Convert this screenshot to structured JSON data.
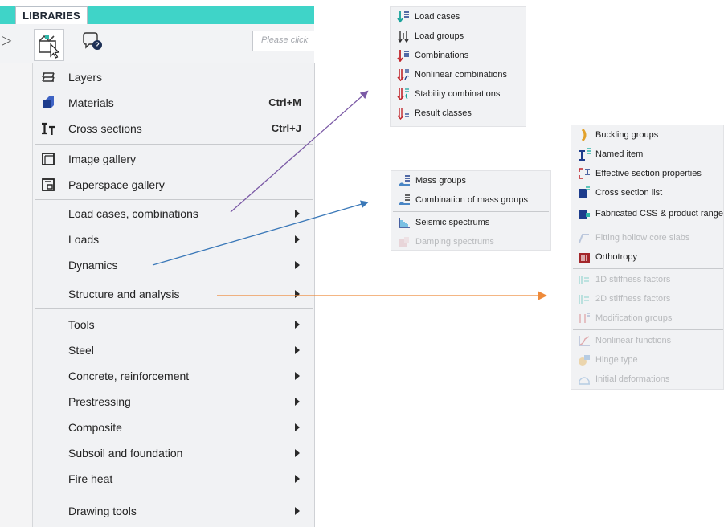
{
  "ribbon": {
    "tab_label": "LIBRARIES",
    "search_placeholder": "Please click"
  },
  "main_menu": {
    "items": [
      {
        "label": "Layers",
        "icon": "layers-icon"
      },
      {
        "label": "Materials",
        "icon": "materials-icon",
        "shortcut": "Ctrl+M"
      },
      {
        "label": "Cross sections",
        "icon": "cross-section-icon",
        "shortcut": "Ctrl+J"
      },
      {
        "label": "Image gallery",
        "icon": "image-gallery-icon"
      },
      {
        "label": "Paperspace gallery",
        "icon": "paperspace-gallery-icon"
      },
      {
        "label": "Load cases, combinations"
      },
      {
        "label": "Loads"
      },
      {
        "label": "Dynamics"
      },
      {
        "label": "Structure and analysis"
      },
      {
        "label": "Tools"
      },
      {
        "label": "Steel"
      },
      {
        "label": "Concrete, reinforcement"
      },
      {
        "label": "Prestressing"
      },
      {
        "label": "Composite"
      },
      {
        "label": "Subsoil and foundation"
      },
      {
        "label": "Fire heat"
      },
      {
        "label": "Drawing tools"
      }
    ]
  },
  "load_cases_submenu": {
    "items": [
      {
        "label": "Load cases"
      },
      {
        "label": "Load groups"
      },
      {
        "label": "Combinations"
      },
      {
        "label": "Nonlinear combinations"
      },
      {
        "label": "Stability combinations"
      },
      {
        "label": "Result classes"
      }
    ]
  },
  "dynamics_submenu": {
    "items": [
      {
        "label": "Mass groups"
      },
      {
        "label": "Combination of mass groups"
      },
      {
        "label": "Seismic spectrums"
      },
      {
        "label": "Damping spectrums",
        "disabled": true
      }
    ]
  },
  "structure_submenu": {
    "items": [
      {
        "label": "Buckling groups"
      },
      {
        "label": "Named item"
      },
      {
        "label": "Effective section properties"
      },
      {
        "label": "Cross section list"
      },
      {
        "label": "Fabricated CSS & product range"
      },
      {
        "label": "Fitting hollow core slabs",
        "disabled": true
      },
      {
        "label": "Orthotropy"
      },
      {
        "label": "1D stiffness factors",
        "disabled": true
      },
      {
        "label": "2D stiffness factors",
        "disabled": true
      },
      {
        "label": "Modification groups",
        "disabled": true
      },
      {
        "label": "Nonlinear functions",
        "disabled": true
      },
      {
        "label": "Hinge type",
        "disabled": true
      },
      {
        "label": "Initial deformations",
        "disabled": true
      }
    ]
  },
  "colors": {
    "ribbon_accent": "#3fd4c8",
    "arrow_load_cases": "#7b5aa6",
    "arrow_dynamics": "#3a78b8",
    "arrow_structure": "#ee8a3a"
  }
}
